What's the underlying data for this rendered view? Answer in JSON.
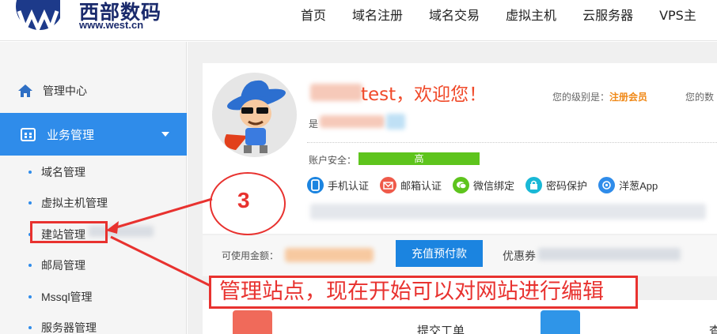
{
  "header": {
    "logo_cn": "西部数码",
    "logo_en": "www.west.cn",
    "nav": [
      "首页",
      "域名注册",
      "域名交易",
      "虚拟主机",
      "云服务器",
      "VPS主"
    ]
  },
  "sidebar": {
    "home_label": "管理中心",
    "group_label": "业务管理",
    "items": [
      "域名管理",
      "虚拟主机管理",
      "建站管理",
      "邮局管理",
      "Mssql管理",
      "服务器管理"
    ]
  },
  "profile": {
    "welcome_suffix": "test，欢迎您！",
    "level_label": "您的级别是：",
    "level_value": "注册会员",
    "level2_label": "您的数",
    "is_label": "是",
    "security_label": "账户安全：",
    "security_value": "高",
    "security_color": "#5ec41d",
    "auth_items": [
      {
        "label": "手机认证",
        "icon": "phone-icon",
        "color": "#1b84e0"
      },
      {
        "label": "邮箱认证",
        "icon": "mail-icon",
        "color": "#ef5a4a"
      },
      {
        "label": "微信绑定",
        "icon": "wechat-icon",
        "color": "#5ec41d"
      },
      {
        "label": "密码保护",
        "icon": "lock-icon",
        "color": "#19b8d6"
      },
      {
        "label": "洋葱App",
        "icon": "onion-app-icon",
        "color": "#2f8cea"
      }
    ]
  },
  "funds": {
    "available_label": "可使用金额：",
    "recharge_button": "充值预付款",
    "coupon_label": "优惠券"
  },
  "bottom": {
    "submit_ticket": "提交工单",
    "cut_text": "查"
  },
  "annotations": {
    "step_number": "3",
    "caption": "管理站点，现在开始可以对网站进行编辑"
  },
  "colors": {
    "accent_blue": "#2f8cea",
    "welcome_red": "#f04a2a",
    "annotation_red": "#e8322f"
  }
}
